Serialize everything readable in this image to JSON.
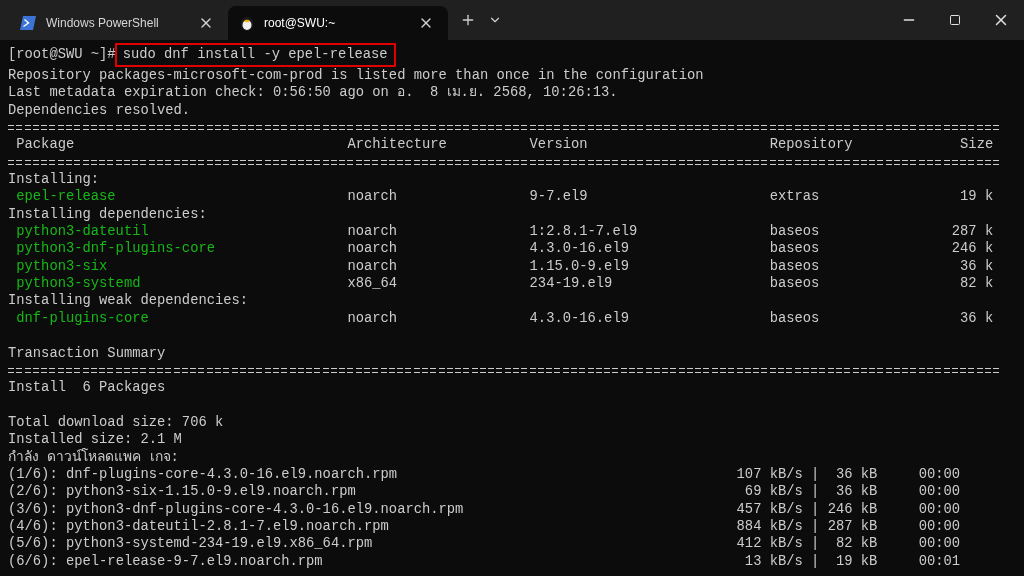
{
  "tabs": [
    {
      "title": "Windows PowerShell",
      "selected": false
    },
    {
      "title": "root@SWU:~",
      "selected": true
    }
  ],
  "terminal": {
    "prompt": "[root@SWU ~]#",
    "command": "sudo dnf install -y epel-release",
    "command_highlighted": true,
    "intro_lines": [
      "Repository packages-microsoft-com-prod is listed more than once in the configuration",
      "Last metadata expiration check: 0:56:50 ago on อ.  8 เม.ย. 2568, 10:26:13.",
      "Dependencies resolved."
    ],
    "table": {
      "columns": [
        "Package",
        "Architecture",
        "Version",
        "Repository",
        "Size"
      ],
      "groups": [
        {
          "heading": "Installing:",
          "rows": [
            {
              "package": "epel-release",
              "arch": "noarch",
              "version": "9-7.el9",
              "repo": "extras",
              "size": "19 k"
            }
          ]
        },
        {
          "heading": "Installing dependencies:",
          "rows": [
            {
              "package": "python3-dateutil",
              "arch": "noarch",
              "version": "1:2.8.1-7.el9",
              "repo": "baseos",
              "size": "287 k"
            },
            {
              "package": "python3-dnf-plugins-core",
              "arch": "noarch",
              "version": "4.3.0-16.el9",
              "repo": "baseos",
              "size": "246 k"
            },
            {
              "package": "python3-six",
              "arch": "noarch",
              "version": "1.15.0-9.el9",
              "repo": "baseos",
              "size": "36 k"
            },
            {
              "package": "python3-systemd",
              "arch": "x86_64",
              "version": "234-19.el9",
              "repo": "baseos",
              "size": "82 k"
            }
          ]
        },
        {
          "heading": "Installing weak dependencies:",
          "rows": [
            {
              "package": "dnf-plugins-core",
              "arch": "noarch",
              "version": "4.3.0-16.el9",
              "repo": "baseos",
              "size": "36 k"
            }
          ]
        }
      ]
    },
    "summary_heading": "Transaction Summary",
    "install_line": "Install  6 Packages",
    "size_lines": [
      "Total download size: 706 k",
      "Installed size: 2.1 M"
    ],
    "download_heading": "กำลัง ดาวน์โหลดแพค เกจ:",
    "downloads": [
      {
        "file": "(1/6): dnf-plugins-core-4.3.0-16.el9.noarch.rpm",
        "speed": "107 kB/s",
        "divider": "|",
        "size": "36 kB",
        "time": "00:00"
      },
      {
        "file": "(2/6): python3-six-1.15.0-9.el9.noarch.rpm",
        "speed": "69 kB/s",
        "divider": "|",
        "size": "36 kB",
        "time": "00:00"
      },
      {
        "file": "(3/6): python3-dnf-plugins-core-4.3.0-16.el9.noarch.rpm",
        "speed": "457 kB/s",
        "divider": "|",
        "size": "246 kB",
        "time": "00:00"
      },
      {
        "file": "(4/6): python3-dateutil-2.8.1-7.el9.noarch.rpm",
        "speed": "884 kB/s",
        "divider": "|",
        "size": "287 kB",
        "time": "00:00"
      },
      {
        "file": "(5/6): python3-systemd-234-19.el9.x86_64.rpm",
        "speed": "412 kB/s",
        "divider": "|",
        "size": "82 kB",
        "time": "00:00"
      },
      {
        "file": "(6/6): epel-release-9-7.el9.noarch.rpm",
        "speed": "13 kB/s",
        "divider": "|",
        "size": "19 kB",
        "time": "00:01"
      }
    ]
  }
}
